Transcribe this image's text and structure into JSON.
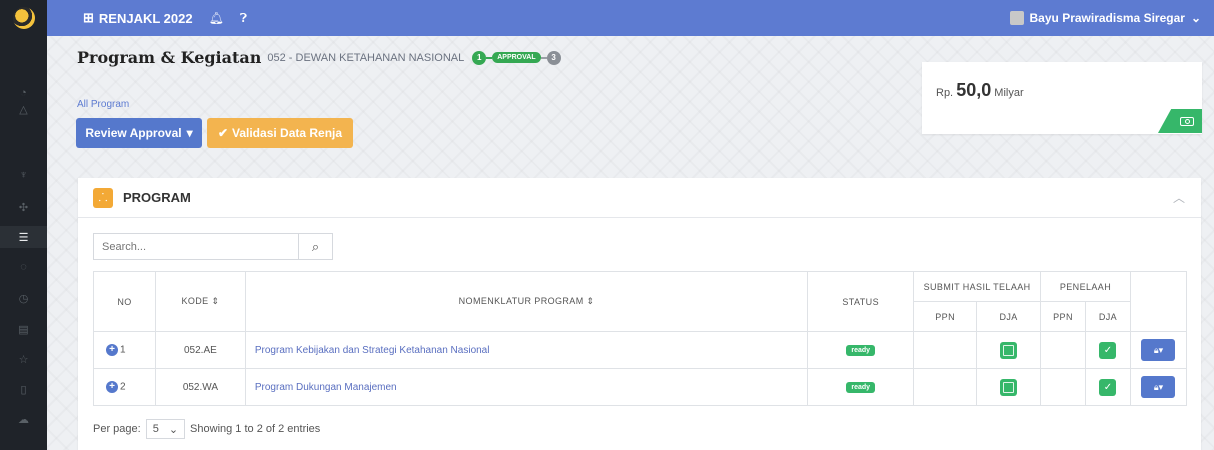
{
  "topbar": {
    "app_name": "RENJAKL 2022",
    "app_icon": "grid-icon",
    "bell_icon": "bell-icon",
    "help_icon": "help-icon",
    "user_name": "Bayu Prawiradisma Siregar"
  },
  "sidebar": {
    "items": [
      {
        "icon": "palette-icon",
        "active": false
      },
      {
        "icon": "home-icon",
        "active": false
      },
      {
        "icon": "trophy-icon",
        "active": false
      },
      {
        "icon": "gear-icon",
        "active": false
      },
      {
        "icon": "list-icon",
        "active": true
      },
      {
        "icon": "search-icon",
        "active": false
      },
      {
        "icon": "clock-icon",
        "active": false
      },
      {
        "icon": "calendar-icon",
        "active": false
      },
      {
        "icon": "star-icon",
        "active": false
      },
      {
        "icon": "file-icon",
        "active": false
      },
      {
        "icon": "cloud-icon",
        "active": false
      }
    ]
  },
  "header": {
    "title": "Program & Kegiatan",
    "subtitle": "052 - DEWAN KETAHANAN NASIONAL",
    "steps": [
      "1",
      "APPROVAL",
      "3"
    ],
    "breadcrumb": "All Program"
  },
  "actions": {
    "review_label": "Review Approval",
    "validate_label": "Validasi Data Renja"
  },
  "budget": {
    "prefix": "Rp.",
    "value": "50,0",
    "unit": "Milyar"
  },
  "card": {
    "title": "PROGRAM"
  },
  "search": {
    "placeholder": "Search..."
  },
  "table": {
    "headers": {
      "no": "NO",
      "kode": "KODE ⇕",
      "nomenklatur": "NOMENKLATUR PROGRAM ⇕",
      "status": "STATUS",
      "submit": "SUBMIT HASIL TELAAH",
      "penelaah": "PENELAAH",
      "ppn": "PPN",
      "dja": "DJA"
    },
    "rows": [
      {
        "no": "1",
        "kode": "052.AE",
        "nama": "Program Kebijakan dan Strategi Ketahanan Nasional",
        "status": "ready",
        "submit_dja": true,
        "penelaah_dja": true
      },
      {
        "no": "2",
        "kode": "052.WA",
        "nama": "Program Dukungan Manajemen",
        "status": "ready",
        "submit_dja": true,
        "penelaah_dja": true
      }
    ]
  },
  "pager": {
    "label": "Per page:",
    "per_page": "5",
    "summary": "Showing 1 to 2 of 2 entries"
  },
  "colors": {
    "topbar": "#5d7bd1",
    "primary": "#5578cc",
    "warning": "#f3b44f",
    "success": "#36b76a",
    "sidebar": "#1f2329"
  }
}
